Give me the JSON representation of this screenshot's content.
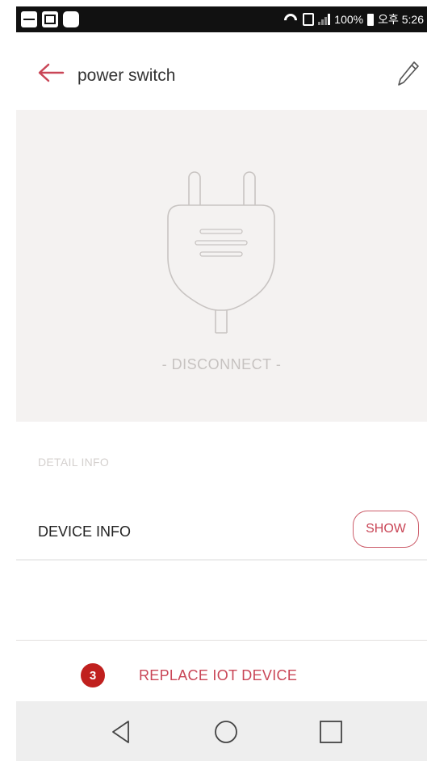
{
  "statusbar": {
    "battery": "100%",
    "time": "오후 5:26"
  },
  "appbar": {
    "title": "power switch",
    "back_icon": "arrow-left-icon",
    "edit_icon": "pencil-icon"
  },
  "device": {
    "icon": "plug-icon",
    "status": "- DISCONNECT -"
  },
  "detail": {
    "section_label": "DETAIL INFO",
    "device_info_label": "DEVICE INFO",
    "show_label": "SHOW"
  },
  "replace": {
    "badge": "3",
    "label": "REPLACE IOT DEVICE"
  },
  "colors": {
    "accent": "#c94556",
    "badge": "#c0201e",
    "hero_bg": "#f4f2f1"
  }
}
